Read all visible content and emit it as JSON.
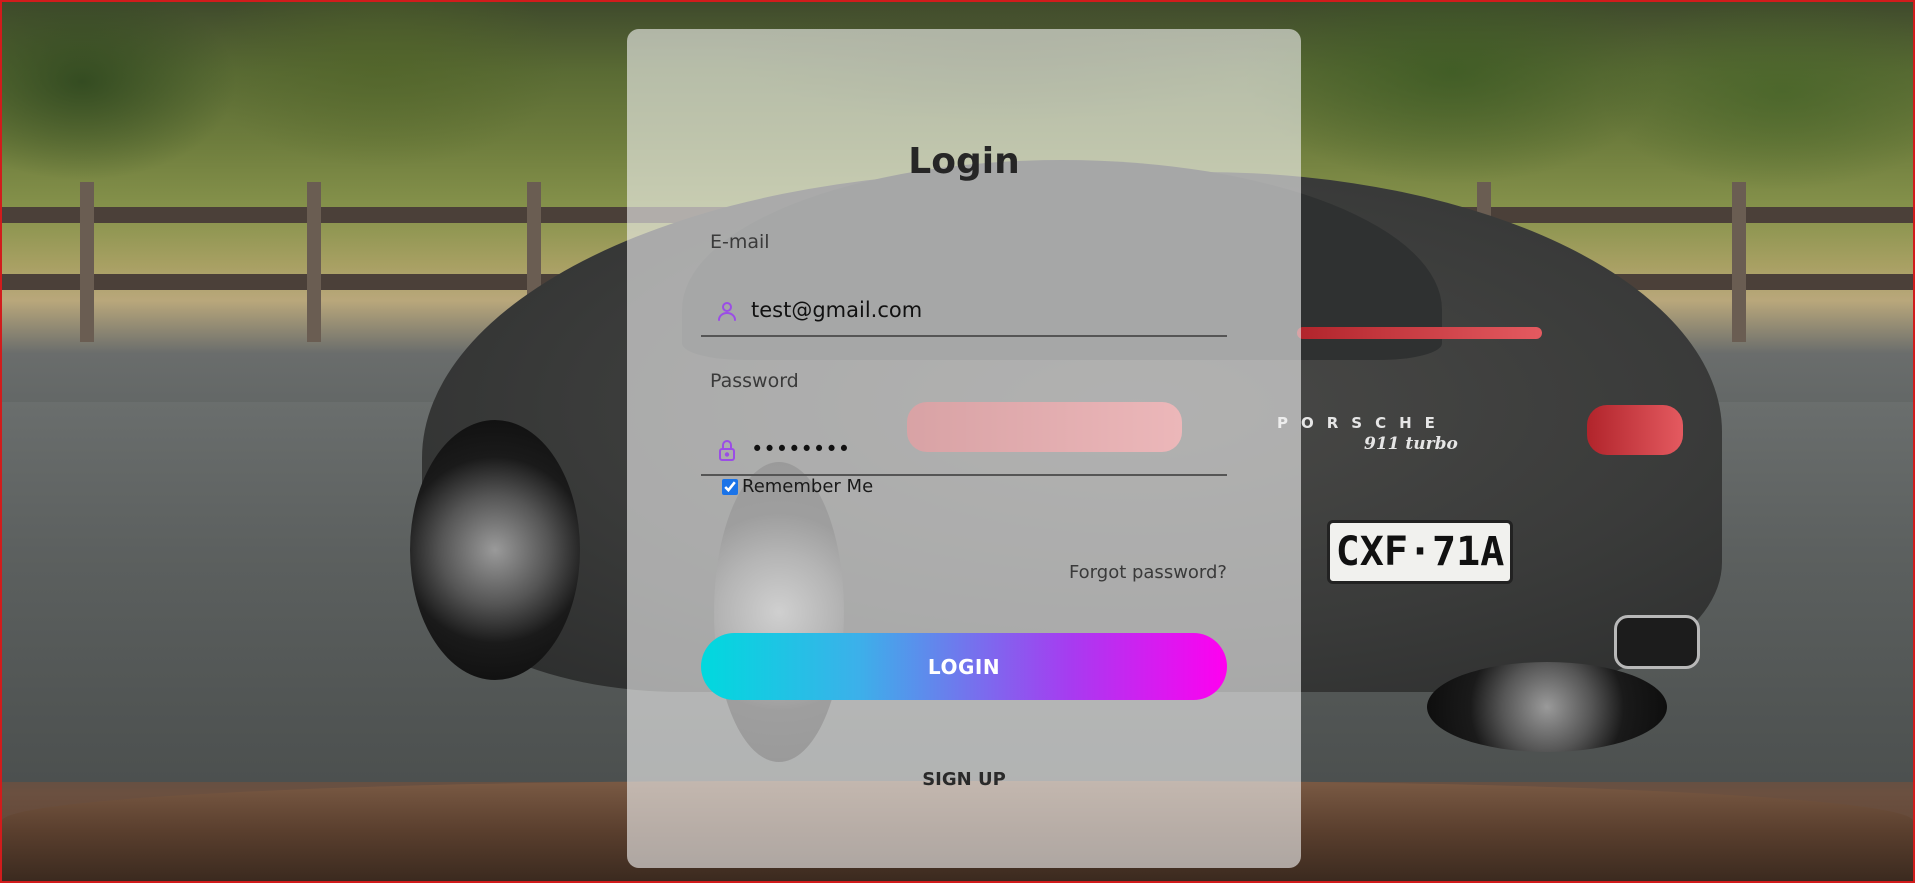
{
  "background": {
    "plate_text": "CXF·71A",
    "brand_text": "PORSCHE",
    "model_text": "911 turbo"
  },
  "login_form": {
    "title": "Login",
    "email": {
      "label": "E-mail",
      "value": "test@gmail.com",
      "icon": "user-icon"
    },
    "password": {
      "label": "Password",
      "value": "password",
      "icon": "lock-icon"
    },
    "remember_me": {
      "label": "Remember Me",
      "checked": true
    },
    "forgot_password": "Forgot password?",
    "login_button": "LOGIN",
    "signup_link": "SIGN UP"
  },
  "colors": {
    "accent_purple": "#9b4de6",
    "button_gradient_start": "#00d9de",
    "button_gradient_end": "#ff00f0",
    "frame_border": "#d11c1c"
  }
}
